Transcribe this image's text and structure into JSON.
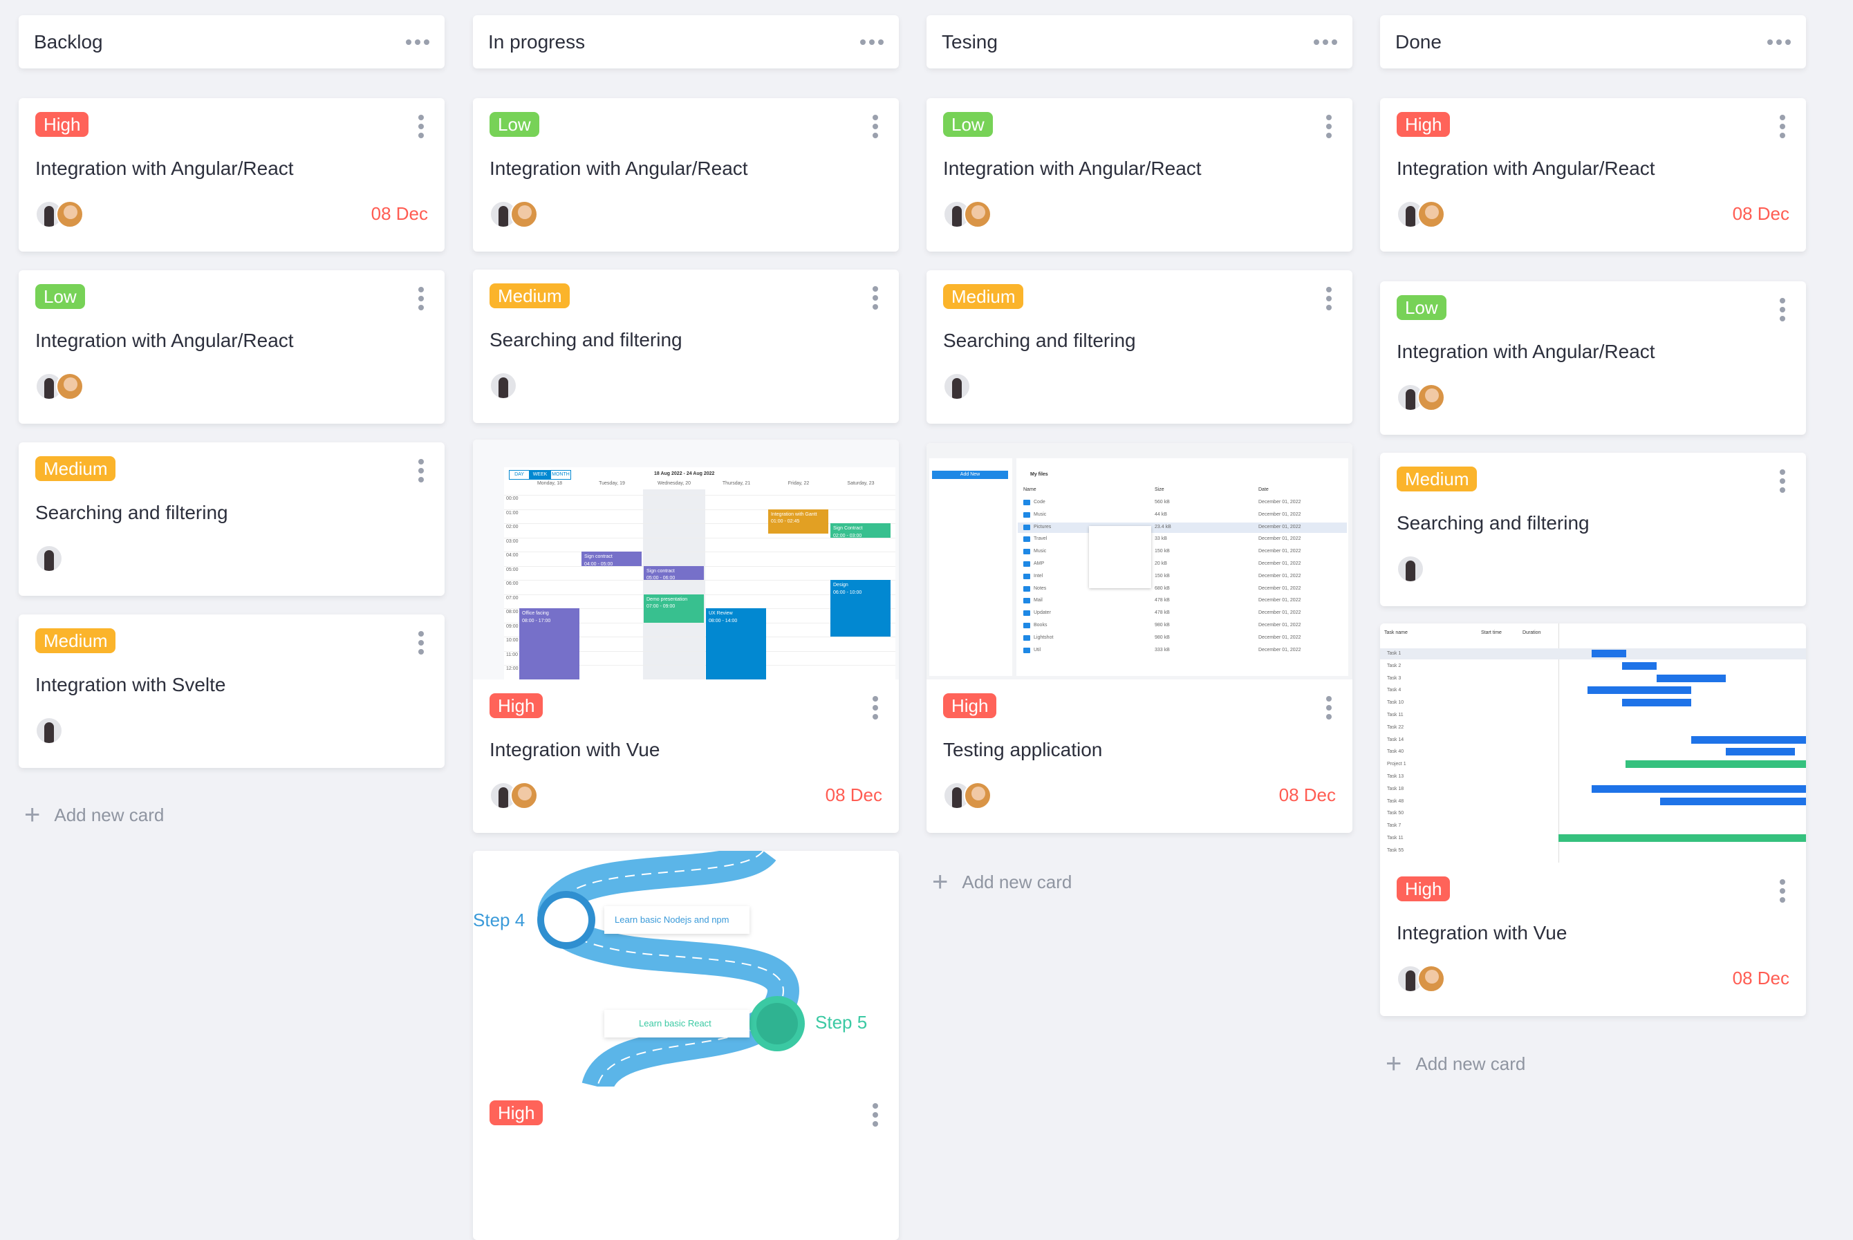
{
  "colors": {
    "high": "#ff6359",
    "low": "#77d257",
    "medium": "#fbb42b",
    "date": "#ff5c52",
    "background": "#f1f2f6"
  },
  "add_label": "Add new card",
  "columns": [
    {
      "title": "Backlog",
      "cards": [
        {
          "priority": "High",
          "title": "Integration with Angular/React",
          "avatars": 2,
          "date": "08 Dec"
        },
        {
          "priority": "Low",
          "title": "Integration with Angular/React",
          "avatars": 2
        },
        {
          "priority": "Medium",
          "title": "Searching and filtering",
          "avatars": 1
        },
        {
          "priority": "Medium",
          "title": "Integration with Svelte",
          "avatars": 1
        }
      ]
    },
    {
      "title": "In progress",
      "cards": [
        {
          "priority": "Low",
          "title": "Integration with Angular/React",
          "avatars": 2
        },
        {
          "priority": "Medium",
          "title": "Searching and filtering",
          "avatars": 1
        },
        {
          "priority": "High",
          "title": "Integration with Vue",
          "avatars": 2,
          "date": "08 Dec",
          "cover": "scheduler"
        },
        {
          "priority": "High",
          "cover": "roadmap"
        }
      ]
    },
    {
      "title": "Tesing",
      "cards": [
        {
          "priority": "Low",
          "title": "Integration with Angular/React",
          "avatars": 2
        },
        {
          "priority": "Medium",
          "title": "Searching and filtering",
          "avatars": 1
        },
        {
          "priority": "High",
          "title": "Testing application",
          "avatars": 2,
          "date": "08 Dec",
          "cover": "file-manager"
        }
      ]
    },
    {
      "title": "Done",
      "cards": [
        {
          "priority": "High",
          "title": "Integration with Angular/React",
          "avatars": 2,
          "date": "08 Dec"
        },
        {
          "priority": "Low",
          "title": "Integration with Angular/React",
          "avatars": 2
        },
        {
          "priority": "Medium",
          "title": "Searching and filtering",
          "avatars": 1
        },
        {
          "priority": "High",
          "title": "Integration with Vue",
          "avatars": 2,
          "date": "08 Dec",
          "cover": "gantt"
        }
      ]
    }
  ],
  "scheduler": {
    "views": [
      "DAY",
      "WEEK",
      "MONTH"
    ],
    "range": "18 Aug 2022 - 24 Aug 2022",
    "days": [
      "Monday, 18",
      "Tuesday, 19",
      "Wednesday, 20",
      "Thursday, 21",
      "Friday, 22",
      "Saturday, 23"
    ],
    "events": [
      {
        "name": "Office facing",
        "time": "08:00 - 17:00"
      },
      {
        "name": "Sign contract",
        "time": "04:00 - 05:00"
      },
      {
        "name": "Sign contract",
        "time": "05:00 - 06:00"
      },
      {
        "name": "Demo presentation",
        "time": "07:00 - 09:00"
      },
      {
        "name": "UX Review",
        "time": "08:00 - 14:00"
      },
      {
        "name": "Integration with Gantt",
        "time": "01:00 - 02:45"
      },
      {
        "name": "Sign Contract",
        "time": "02:00 - 03:00"
      },
      {
        "name": "Design",
        "time": "06:00 - 10:00"
      }
    ]
  },
  "filemanager": {
    "title": "My files",
    "add": "Add New",
    "columns": [
      "Name",
      "Size",
      "Date"
    ],
    "rows": [
      [
        "Code",
        "560 kB"
      ],
      [
        "Music",
        "44 kB"
      ],
      [
        "Pictures",
        "23.4 kB"
      ],
      [
        "Travel",
        "33 kB"
      ],
      [
        "Music",
        "150 kB"
      ],
      [
        "AMP",
        "20 kB"
      ],
      [
        "Intel",
        "150 kB"
      ],
      [
        "Notes",
        "680 kB"
      ],
      [
        "Mail",
        "478 kB"
      ],
      [
        "Updater",
        "478 kB"
      ],
      [
        "Books",
        "980 kB"
      ],
      [
        "Lightshot",
        "980 kB"
      ],
      [
        "Util",
        "333 kB"
      ]
    ],
    "date": "December 01, 2022"
  },
  "gantt": {
    "columns": [
      "Task name",
      "Start time",
      "Duration"
    ],
    "tasks": [
      "Task 1",
      "Task 2",
      "Task 3",
      "Task 4",
      "Task 10",
      "Task 11",
      "Task 22",
      "Task 14",
      "Task 40",
      "Project 1",
      "Task 13",
      "Task 18",
      "Task 48",
      "Task 50",
      "Task 7",
      "Task 11",
      "Task 55"
    ]
  },
  "roadmap": {
    "step4": "Step 4",
    "step4_text": "Learn basic Nodejs and npm",
    "step5": "Step 5",
    "step5_text": "Learn basic React"
  }
}
